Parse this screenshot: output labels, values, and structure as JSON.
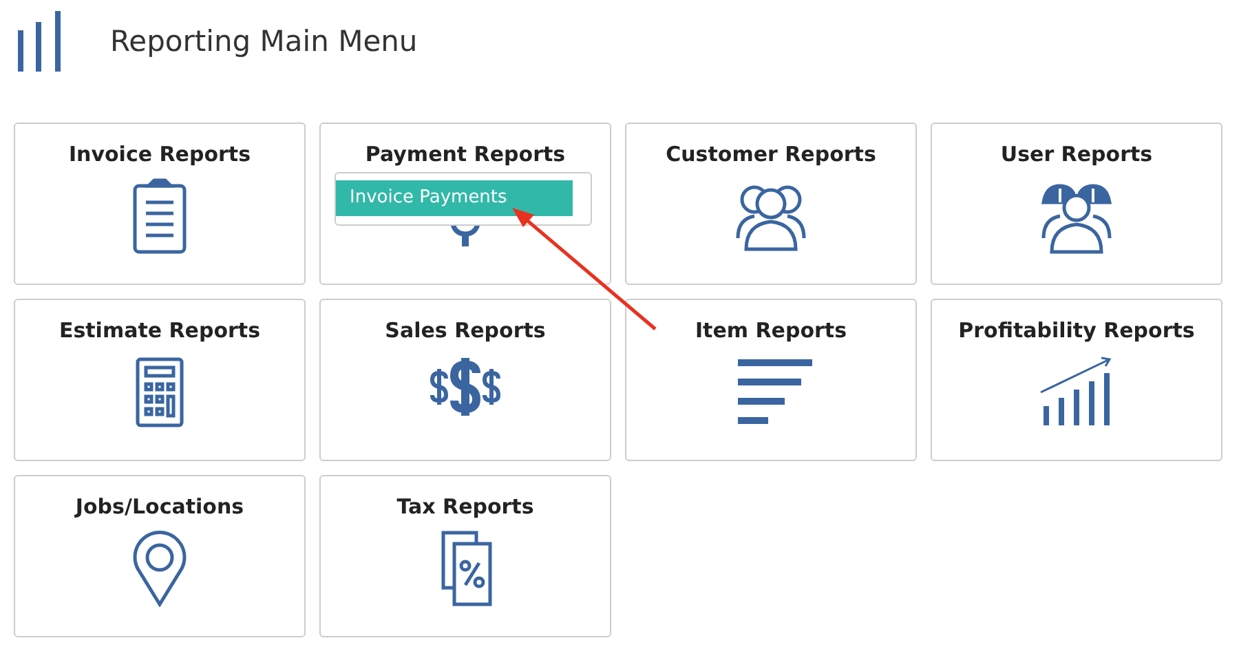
{
  "header": {
    "title": "Reporting Main Menu"
  },
  "cards": [
    {
      "title": "Invoice Reports"
    },
    {
      "title": "Payment Reports",
      "menu": {
        "items": [
          {
            "label": "Invoice Payments",
            "selected": true
          }
        ]
      }
    },
    {
      "title": "Customer Reports"
    },
    {
      "title": "User Reports"
    },
    {
      "title": "Estimate Reports"
    },
    {
      "title": "Sales Reports"
    },
    {
      "title": "Item Reports"
    },
    {
      "title": "Profitability Reports"
    },
    {
      "title": "Jobs/Locations"
    },
    {
      "title": "Tax Reports"
    }
  ]
}
